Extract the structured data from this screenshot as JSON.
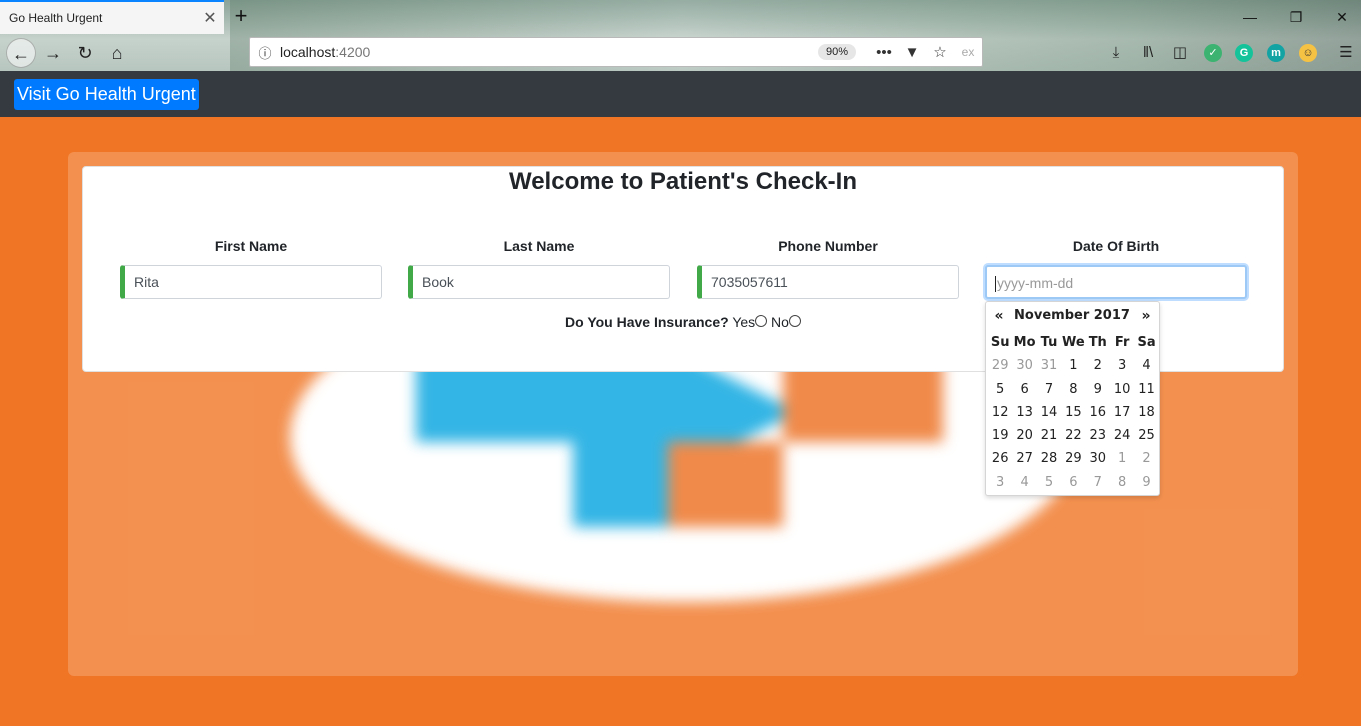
{
  "browser": {
    "tab_title": "Go Health Urgent",
    "tab_close": "✕",
    "new_tab": "+",
    "url_host": "localhost",
    "url_port": ":4200",
    "zoom": "90%",
    "window_controls": {
      "minimize": "—",
      "restore": "❐",
      "close": "✕"
    }
  },
  "app": {
    "brand_button": "Visit Go Health Urgent"
  },
  "form": {
    "title": "Welcome to Patient's Check-In",
    "fields": [
      {
        "label": "First Name",
        "value": "Rita"
      },
      {
        "label": "Last Name",
        "value": "Book"
      },
      {
        "label": "Phone Number",
        "value": "7035057611"
      },
      {
        "label": "Date Of Birth",
        "value": "",
        "placeholder": "yyyy-mm-dd"
      }
    ],
    "insurance": {
      "question": "Do You Have Insurance?",
      "options": [
        "Yes",
        "No"
      ]
    }
  },
  "datepicker": {
    "month_label": "November 2017",
    "prev": "«",
    "next": "»",
    "weekdays": [
      "Su",
      "Mo",
      "Tu",
      "We",
      "Th",
      "Fr",
      "Sa"
    ],
    "weeks": [
      [
        "29",
        "30",
        "31",
        "1",
        "2",
        "3",
        "4"
      ],
      [
        "5",
        "6",
        "7",
        "8",
        "9",
        "10",
        "11"
      ],
      [
        "12",
        "13",
        "14",
        "15",
        "16",
        "17",
        "18"
      ],
      [
        "19",
        "20",
        "21",
        "22",
        "23",
        "24",
        "25"
      ],
      [
        "26",
        "27",
        "28",
        "29",
        "30",
        "1",
        "2"
      ],
      [
        "3",
        "4",
        "5",
        "6",
        "7",
        "8",
        "9"
      ]
    ],
    "muted_first_week_count": 3,
    "muted_fifth_week_from": 5
  },
  "colors": {
    "page_bg": "#f07524",
    "nav_bg": "#343a40",
    "brand_button": "#007bff",
    "valid_field_border": "#42a948",
    "logo_blue": "#33b5e5"
  }
}
